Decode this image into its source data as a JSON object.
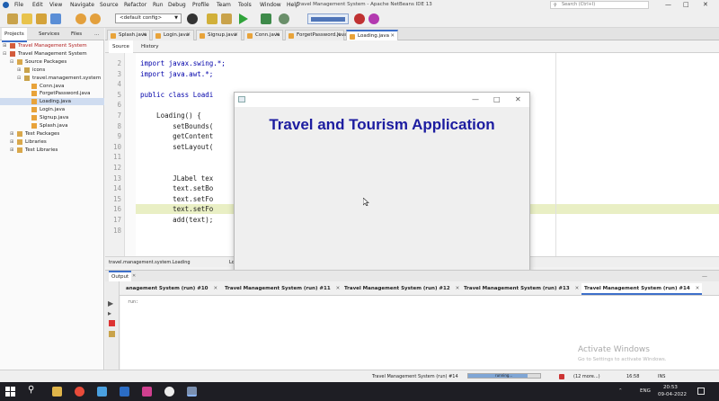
{
  "app": {
    "title": "Travel Management System - Apache NetBeans IDE 13",
    "search_placeholder": "Search (Ctrl+I)"
  },
  "menu": [
    "File",
    "Edit",
    "View",
    "Navigate",
    "Source",
    "Refactor",
    "Run",
    "Debug",
    "Profile",
    "Team",
    "Tools",
    "Window",
    "Help"
  ],
  "toolbar": {
    "config": "<default config>"
  },
  "left_panel": {
    "tabs": [
      "Projects",
      "Services",
      "Files",
      "..."
    ],
    "tree": [
      {
        "label": "Travel Management System",
        "indent": 0,
        "toggle": "⊞",
        "icon": "project-icon"
      },
      {
        "label": "Travel Management System",
        "indent": 0,
        "toggle": "⊟",
        "icon": "project-icon"
      },
      {
        "label": "Source Packages",
        "indent": 1,
        "toggle": "⊟",
        "icon": "folder-icon"
      },
      {
        "label": "icons",
        "indent": 2,
        "toggle": "⊞",
        "icon": "package-icon"
      },
      {
        "label": "travel.management.system",
        "indent": 2,
        "toggle": "⊟",
        "icon": "package-icon"
      },
      {
        "label": "Conn.java",
        "indent": 3,
        "toggle": "",
        "icon": "java-file-icon"
      },
      {
        "label": "ForgetPassword.java",
        "indent": 3,
        "toggle": "",
        "icon": "java-file-icon"
      },
      {
        "label": "Loading.java",
        "indent": 3,
        "toggle": "",
        "icon": "java-file-icon",
        "selected": true
      },
      {
        "label": "Login.java",
        "indent": 3,
        "toggle": "",
        "icon": "java-file-icon"
      },
      {
        "label": "Signup.java",
        "indent": 3,
        "toggle": "",
        "icon": "java-file-icon"
      },
      {
        "label": "Splash.java",
        "indent": 3,
        "toggle": "",
        "icon": "java-file-icon"
      },
      {
        "label": "Test Packages",
        "indent": 1,
        "toggle": "⊞",
        "icon": "folder-icon"
      },
      {
        "label": "Libraries",
        "indent": 1,
        "toggle": "⊞",
        "icon": "folder-icon"
      },
      {
        "label": "Test Libraries",
        "indent": 1,
        "toggle": "⊞",
        "icon": "folder-icon"
      }
    ]
  },
  "editor": {
    "tabs": [
      {
        "label": "Splash.java",
        "active": false
      },
      {
        "label": "Login.java",
        "active": false
      },
      {
        "label": "Signup.java",
        "active": false
      },
      {
        "label": "Conn.java",
        "active": false
      },
      {
        "label": "ForgetPassword.java",
        "active": false
      },
      {
        "label": "Loading.java",
        "active": true
      }
    ],
    "source_tab": "Source",
    "history_tab": "History",
    "lines": [
      {
        "n": "2",
        "code": "import javax.swing.*;"
      },
      {
        "n": "3",
        "code": "import java.awt.*;"
      },
      {
        "n": "4",
        "code": ""
      },
      {
        "n": "5",
        "code": "public class Loadi"
      },
      {
        "n": "6",
        "code": ""
      },
      {
        "n": "7",
        "code": "    Loading() {"
      },
      {
        "n": "8",
        "code": "        setBounds("
      },
      {
        "n": "9",
        "code": "        getContent"
      },
      {
        "n": "10",
        "code": "        setLayout("
      },
      {
        "n": "11",
        "code": ""
      },
      {
        "n": "12",
        "code": ""
      },
      {
        "n": "13",
        "code": "        JLabel tex"
      },
      {
        "n": "14",
        "code": "        text.setBo"
      },
      {
        "n": "15",
        "code": "        text.setFo"
      },
      {
        "n": "16",
        "code": "        text.setFo",
        "highlight": true
      },
      {
        "n": "17",
        "code": "        add(text);"
      },
      {
        "n": "18",
        "code": ""
      }
    ],
    "breadcrumb": [
      "travel.management.system.Loading",
      "Lo"
    ]
  },
  "jframe": {
    "heading": "Travel and Tourism Application",
    "min": "—",
    "max": "□",
    "close": "✕"
  },
  "output": {
    "header": "Output",
    "tabs": [
      {
        "label": "anagement System (run) #10",
        "active": false
      },
      {
        "label": "Travel Management System (run) #11",
        "active": false
      },
      {
        "label": "Travel Management System (run) #12",
        "active": false
      },
      {
        "label": "Travel Management System (run) #13",
        "active": false
      },
      {
        "label": "Travel Management System (run) #14",
        "active": true
      }
    ],
    "first_line": "run:"
  },
  "watermark": {
    "title": "Activate Windows",
    "subtitle": "Go to Settings to activate Windows."
  },
  "status": {
    "task": "Travel Management System (run) #14",
    "progress_label": "running...",
    "more": "(12 more...)",
    "position": "16:58",
    "mode": "INS"
  },
  "taskbar": {
    "lang": "ENG",
    "time": "20:53",
    "date": "09-04-2022"
  }
}
